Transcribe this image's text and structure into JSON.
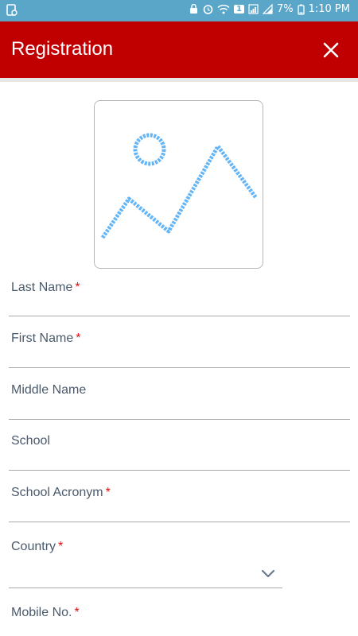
{
  "status_bar": {
    "battery": "7%",
    "time": "1:10 PM",
    "sim_badge": "1"
  },
  "app_bar": {
    "title": "Registration"
  },
  "form": {
    "last_name_label": "Last Name",
    "first_name_label": "First Name",
    "middle_name_label": "Middle Name",
    "school_label": "School",
    "school_acronym_label": "School Acronym",
    "country_label": "Country",
    "mobile_label": "Mobile No.",
    "required_marker": "*"
  },
  "icons": {
    "photo": "image-placeholder-icon",
    "close": "close-icon",
    "dropdown": "chevron-down-icon"
  },
  "colors": {
    "app_bar": "#c00000",
    "status_bar": "#5aa6c8",
    "required": "#e01010",
    "placeholder_icon": "#64b5f6"
  }
}
